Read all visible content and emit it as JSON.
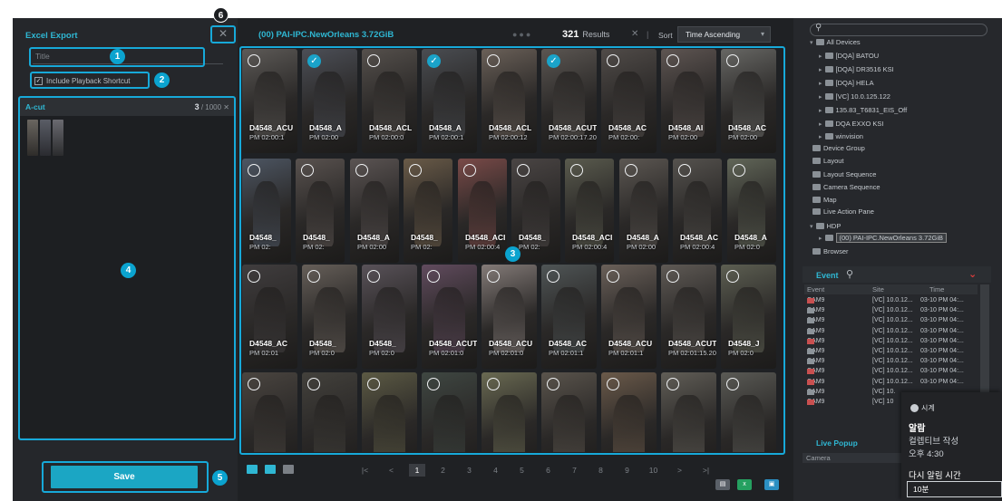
{
  "colors": {
    "accent": "#2fb7d3",
    "highlight": "#17a9d9",
    "panel": "#25272b",
    "save_button": "#1ba6c4"
  },
  "left_panel": {
    "title": "Excel Export",
    "close_icon": "close-icon",
    "title_placeholder": "Title",
    "include_playback_label": "Include Playback Shortcut",
    "include_playback_checked": true,
    "acut": {
      "label": "A-cut",
      "count": "3",
      "max": "/ 1000",
      "thumbnails": 3
    },
    "save_label": "Save"
  },
  "badges": [
    "1",
    "2",
    "3",
    "4",
    "5",
    "6"
  ],
  "center": {
    "title": "(00) PAI-IPC.NewOrleans 3.72GiB",
    "results_count": "321",
    "results_label": "Results",
    "sort_label": "Sort",
    "sort_value": "Time Ascending",
    "rows": [
      [
        {
          "name": "D4548_ACU",
          "time": "PM 02:00:1",
          "checked": false,
          "tint": "#5d5a57"
        },
        {
          "name": "D4548_A",
          "time": "PM 02:00",
          "checked": true,
          "tint": "#4c4f57"
        },
        {
          "name": "D4548_ACL",
          "time": "PM 02:00:0",
          "checked": false,
          "tint": "#55504c"
        },
        {
          "name": "D4548_A",
          "time": "PM 02:00:1",
          "checked": true,
          "tint": "#4a4d52"
        },
        {
          "name": "D4548_ACL",
          "time": "PM 02:00:12",
          "checked": false,
          "tint": "#6a6058"
        },
        {
          "name": "D4548_ACUT",
          "time": "PM 02:00:17.20",
          "checked": true,
          "tint": "#5b5652"
        },
        {
          "name": "D4548_AC",
          "time": "PM 02:00:",
          "checked": false,
          "tint": "#504b48"
        },
        {
          "name": "D4548_AI",
          "time": "PM 02:00",
          "checked": false,
          "tint": "#5e5552"
        },
        {
          "name": "D4548_AC",
          "time": "PM 02:00",
          "checked": false,
          "tint": "#676764"
        }
      ],
      [
        {
          "name": "D4548_",
          "time": "PM 02:",
          "checked": false,
          "tint": "#4d5663"
        },
        {
          "name": "D4548_",
          "time": "PM 02:",
          "checked": false,
          "tint": "#59524f"
        },
        {
          "name": "D4548_A",
          "time": "PM 02:00",
          "checked": false,
          "tint": "#5b5453"
        },
        {
          "name": "D4548_",
          "time": "PM 02:",
          "checked": false,
          "tint": "#6a5b48"
        },
        {
          "name": "D4548_ACI",
          "time": "PM 02:00:4",
          "checked": false,
          "tint": "#7a4a48"
        },
        {
          "name": "D4548_",
          "time": "PM 02:",
          "checked": false,
          "tint": "#4a4544"
        },
        {
          "name": "D4548_ACI",
          "time": "PM 02:00:4",
          "checked": false,
          "tint": "#5a5b4e"
        },
        {
          "name": "D4548_A",
          "time": "PM 02:00",
          "checked": false,
          "tint": "#5c5752"
        },
        {
          "name": "D4548_AC",
          "time": "PM 02:00:4",
          "checked": false,
          "tint": "#55524e"
        },
        {
          "name": "D4548_A",
          "time": "PM 02:0",
          "checked": false,
          "tint": "#616658"
        }
      ],
      [
        {
          "name": "D4548_AC",
          "time": "PM 02:01",
          "checked": false,
          "tint": "#403d3e"
        },
        {
          "name": "D4548_",
          "time": "PM 02:0",
          "checked": false,
          "tint": "#665f59"
        },
        {
          "name": "D4548_",
          "time": "PM 02:0",
          "checked": false,
          "tint": "#595259"
        },
        {
          "name": "D4548_ACUT",
          "time": "PM 02:01:0",
          "checked": false,
          "tint": "#614b5e"
        },
        {
          "name": "D4548_ACU",
          "time": "PM 02:01:0",
          "checked": false,
          "tint": "#847b78"
        },
        {
          "name": "D4548_AC",
          "time": "PM 02:01:1",
          "checked": false,
          "tint": "#4f5556"
        },
        {
          "name": "D4548_ACU",
          "time": "PM 02:01:1",
          "checked": false,
          "tint": "#6a6059"
        },
        {
          "name": "D4548_ACUT",
          "time": "PM 02:01:15.20",
          "checked": false,
          "tint": "#5f5a55"
        },
        {
          "name": "D4548_J",
          "time": "PM 02:0",
          "checked": false,
          "tint": "#5d5f52"
        }
      ],
      [
        {
          "name": "",
          "time": "",
          "checked": false,
          "tint": "#4a4540"
        },
        {
          "name": "",
          "time": "",
          "checked": false,
          "tint": "#43413c"
        },
        {
          "name": "",
          "time": "",
          "checked": false,
          "tint": "#5c5a44"
        },
        {
          "name": "",
          "time": "",
          "checked": false,
          "tint": "#3f4742"
        },
        {
          "name": "",
          "time": "",
          "checked": false,
          "tint": "#6a6a52"
        },
        {
          "name": "",
          "time": "",
          "checked": false,
          "tint": "#5a544c"
        },
        {
          "name": "",
          "time": "",
          "checked": false,
          "tint": "#6b5a4a"
        },
        {
          "name": "",
          "time": "",
          "checked": false,
          "tint": "#615e57"
        },
        {
          "name": "",
          "time": "",
          "checked": false,
          "tint": "#5a5a55"
        }
      ]
    ],
    "pager": {
      "first": "|<",
      "prev": "<",
      "pages": [
        "1",
        "2",
        "3",
        "4",
        "5",
        "6",
        "7",
        "8",
        "9",
        "10"
      ],
      "current": "1",
      "next": ">",
      "last": ">|"
    }
  },
  "right_panel": {
    "tree": [
      {
        "label": "All Devices",
        "indent": 0,
        "arrow": "▾"
      },
      {
        "label": "[DQA] BATOU",
        "indent": 1,
        "arrow": "▸"
      },
      {
        "label": "[DQA] DR3516 KSI",
        "indent": 1,
        "arrow": "▸"
      },
      {
        "label": "[DQA] HELA",
        "indent": 1,
        "arrow": "▸"
      },
      {
        "label": "[VC] 10.0.125.122",
        "indent": 1,
        "arrow": "▸"
      },
      {
        "label": "135.83_T6831_EIS_Off",
        "indent": 1,
        "arrow": "▸"
      },
      {
        "label": "DQA EXXO KSI",
        "indent": 1,
        "arrow": "▸"
      },
      {
        "label": "winvision",
        "indent": 1,
        "arrow": "▸"
      },
      {
        "label": "Device Group",
        "indent": 0,
        "arrow": ""
      },
      {
        "label": "Layout",
        "indent": 0,
        "arrow": ""
      },
      {
        "label": "Layout Sequence",
        "indent": 0,
        "arrow": ""
      },
      {
        "label": "Camera Sequence",
        "indent": 0,
        "arrow": ""
      },
      {
        "label": "Map",
        "indent": 0,
        "arrow": ""
      },
      {
        "label": "Live Action Pane",
        "indent": 0,
        "arrow": ""
      },
      {
        "label": "HDP",
        "indent": 0,
        "arrow": "▾"
      },
      {
        "label": "(00) PAI-IPC.NewOrleans 3.72GiB",
        "indent": 1,
        "arrow": "▸"
      },
      {
        "label": "Browser",
        "indent": 0,
        "arrow": ""
      }
    ],
    "event": {
      "title": "Event",
      "columns": [
        "Event",
        "Site",
        "Time"
      ],
      "rows": [
        {
          "event": "CAM9",
          "site": "[VC] 10.0.12...",
          "time": "03-10 PM 04:...",
          "red": true
        },
        {
          "event": "CAM9",
          "site": "[VC] 10.0.12...",
          "time": "03-10 PM 04:...",
          "red": false
        },
        {
          "event": "CAM9",
          "site": "[VC] 10.0.12...",
          "time": "03-10 PM 04:...",
          "red": false
        },
        {
          "event": "CAM9",
          "site": "[VC] 10.0.12...",
          "time": "03-10 PM 04:...",
          "red": false
        },
        {
          "event": "CAM9",
          "site": "[VC] 10.0.12...",
          "time": "03-10 PM 04:...",
          "red": true
        },
        {
          "event": "CAM9",
          "site": "[VC] 10.0.12...",
          "time": "03-10 PM 04:...",
          "red": false
        },
        {
          "event": "CAM9",
          "site": "[VC] 10.0.12...",
          "time": "03-10 PM 04:...",
          "red": false
        },
        {
          "event": "CAM9",
          "site": "[VC] 10.0.12...",
          "time": "03-10 PM 04:...",
          "red": true
        },
        {
          "event": "CAM9",
          "site": "[VC] 10.0.12...",
          "time": "03-10 PM 04:...",
          "red": true
        },
        {
          "event": "CAM9",
          "site": "[VC] 10.",
          "time": "",
          "red": false
        },
        {
          "event": "CAM9",
          "site": "[VC] 10",
          "time": "",
          "red": true
        }
      ]
    },
    "live_popup": {
      "title": "Live Popup",
      "column": "Camera"
    }
  },
  "toast": {
    "app": "시계",
    "heading": "알람",
    "line1": "컬렙티브 작성",
    "line2": "오후 4:30",
    "snooze_label": "다시 알림 시간",
    "snooze_value": "10분"
  }
}
